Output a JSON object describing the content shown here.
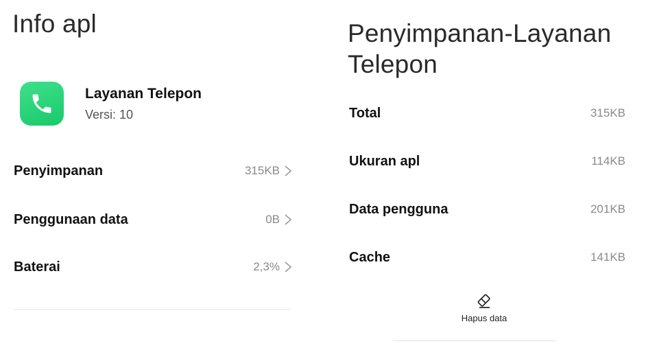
{
  "left_panel": {
    "title": "Info apl",
    "app": {
      "name": "Layanan Telepon",
      "version": "Versi: 10",
      "icon": "phone-icon",
      "icon_color": "#2ad577"
    },
    "rows": [
      {
        "label": "Penyimpanan",
        "value": "315KB"
      },
      {
        "label": "Penggunaan data",
        "value": "0B"
      },
      {
        "label": "Baterai",
        "value": "2,3%"
      }
    ]
  },
  "right_panel": {
    "title": "Penyimpanan-Layanan Telepon",
    "rows": [
      {
        "label": "Total",
        "value": "315KB"
      },
      {
        "label": "Ukuran apl",
        "value": "114KB"
      },
      {
        "label": "Data pengguna",
        "value": "201KB"
      },
      {
        "label": "Cache",
        "value": "141KB"
      }
    ],
    "clear_button": {
      "label": "Hapus data",
      "icon": "eraser-icon"
    }
  }
}
